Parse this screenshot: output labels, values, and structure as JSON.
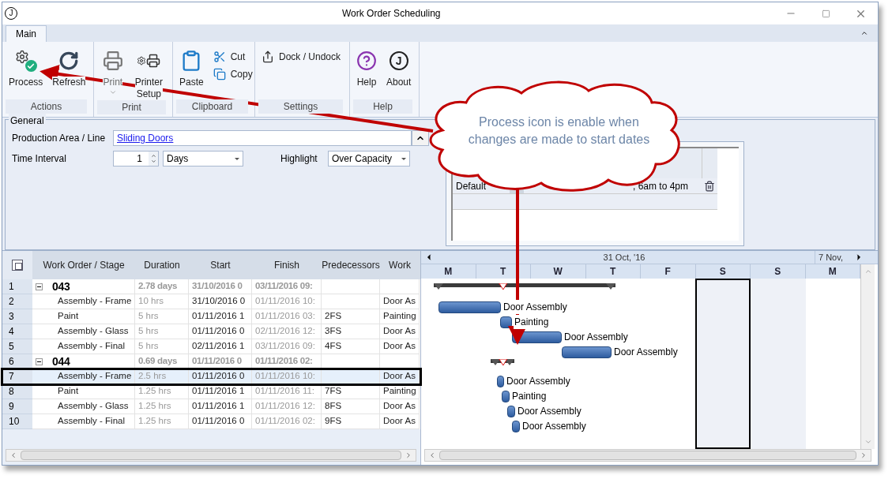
{
  "window": {
    "logo": "J",
    "title": "Work Order Scheduling"
  },
  "tabs": [
    {
      "label": "Main",
      "selected": true
    }
  ],
  "ribbon_groups": [
    {
      "label": "Actions",
      "buttons": [
        {
          "label": "Process",
          "kind": "large",
          "disabled": false
        },
        {
          "label": "Refresh",
          "kind": "large",
          "disabled": false
        }
      ]
    },
    {
      "label": "Print",
      "buttons": [
        {
          "label": "Print",
          "kind": "split",
          "disabled": true
        },
        {
          "label": "Printer Setup",
          "kind": "large",
          "disabled": false
        }
      ]
    },
    {
      "label": "Clipboard",
      "buttons": [
        {
          "label": "Paste",
          "kind": "large",
          "disabled": false
        },
        {
          "label": "Cut",
          "kind": "small",
          "disabled": false
        },
        {
          "label": "Copy",
          "kind": "small",
          "disabled": false
        }
      ]
    },
    {
      "label": "Settings",
      "buttons": [
        {
          "label": "Dock / Undock",
          "kind": "small",
          "disabled": false
        }
      ]
    },
    {
      "label": "Help",
      "buttons": [
        {
          "label": "Help",
          "kind": "large",
          "disabled": false
        },
        {
          "label": "About",
          "kind": "large",
          "disabled": false,
          "icon_letter": "J"
        }
      ]
    }
  ],
  "general": {
    "legend": "General",
    "production_area": {
      "label": "Production Area / Line",
      "value": "Sliding Doors"
    },
    "time_interval": {
      "label": "Time Interval",
      "value": "1",
      "unit": "Days"
    },
    "highlight": {
      "label": "Highlight",
      "value": "Over Capacity"
    },
    "shifts": {
      "rows": [
        {
          "column_1": "Default",
          "column_3": ", 6am to 4pm"
        }
      ]
    }
  },
  "grid": {
    "columns": [
      "Work Order / Stage",
      "Duration",
      "Start",
      "Finish",
      "Predecessors",
      "Work"
    ],
    "rows": [
      {
        "number": "1",
        "kind": "order",
        "expanded": true,
        "selected": false,
        "name": "043",
        "duration": "2.78 days",
        "start": "31/10/2016 0",
        "finish": "03/11/2016 09:",
        "predecessors": "",
        "work": ""
      },
      {
        "number": "2",
        "kind": "stage",
        "selected": false,
        "name": "Assembly - Frame",
        "duration": "10 hrs",
        "start": "31/10/2016 0",
        "finish": "01/11/2016 10:",
        "predecessors": "",
        "work": "Door As"
      },
      {
        "number": "3",
        "kind": "stage",
        "selected": false,
        "name": "Paint",
        "duration": "5 hrs",
        "start": "01/11/2016 1",
        "finish": "01/11/2016 03:",
        "predecessors": "2FS",
        "work": "Painting"
      },
      {
        "number": "4",
        "kind": "stage",
        "selected": false,
        "name": "Assembly - Glass",
        "duration": "5 hrs",
        "start": "01/11/2016 0",
        "finish": "02/11/2016 12:",
        "predecessors": "3FS",
        "work": "Door As"
      },
      {
        "number": "5",
        "kind": "stage",
        "selected": false,
        "name": "Assembly - Final",
        "duration": "5 hrs",
        "start": "02/11/2016 1",
        "finish": "03/11/2016 09:",
        "predecessors": "4FS",
        "work": "Door As"
      },
      {
        "number": "6",
        "kind": "order",
        "expanded": true,
        "selected": false,
        "name": "044",
        "duration": "0.69 days",
        "start": "01/11/2016 0",
        "finish": "01/11/2016 02:",
        "predecessors": "",
        "work": ""
      },
      {
        "number": "7",
        "kind": "stage",
        "selected": true,
        "name": "Assembly - Frame",
        "duration": "2.5 hrs",
        "start": "01/11/2016 0",
        "finish": "01/11/2016 10:",
        "predecessors": "",
        "work": "Door As"
      },
      {
        "number": "8",
        "kind": "stage",
        "selected": false,
        "name": "Paint",
        "duration": "1.25 hrs",
        "start": "01/11/2016 1",
        "finish": "01/11/2016 11:",
        "predecessors": "7FS",
        "work": "Painting"
      },
      {
        "number": "9",
        "kind": "stage",
        "selected": false,
        "name": "Assembly - Glass",
        "duration": "1.25 hrs",
        "start": "01/11/2016 1",
        "finish": "01/11/2016 12:",
        "predecessors": "8FS",
        "work": "Door As"
      },
      {
        "number": "10",
        "kind": "stage",
        "selected": false,
        "name": "Assembly - Final",
        "duration": "1.25 hrs",
        "start": "01/11/2016 0",
        "finish": "01/11/2016 02:",
        "predecessors": "9FS",
        "work": "Door As"
      }
    ]
  },
  "gantt": {
    "periods": [
      "31 Oct, '16",
      "7 Nov,"
    ],
    "days": [
      {
        "label": "M",
        "kind": "weekday"
      },
      {
        "label": "T",
        "kind": "weekday"
      },
      {
        "label": "W",
        "kind": "weekday"
      },
      {
        "label": "T",
        "kind": "weekday"
      },
      {
        "label": "F",
        "kind": "weekday"
      },
      {
        "label": "S",
        "kind": "weekend",
        "selected": true
      },
      {
        "label": "S",
        "kind": "weekend",
        "selected": false
      },
      {
        "label": "M",
        "kind": "weekday"
      }
    ],
    "bars": [
      {
        "kind": "summary"
      },
      {
        "kind": "task",
        "label": "Door Assembly"
      },
      {
        "kind": "task",
        "label": "Painting"
      },
      {
        "kind": "task",
        "label": "Door Assembly"
      },
      {
        "kind": "task",
        "label": "Door Assembly"
      },
      {
        "kind": "summary"
      },
      {
        "kind": "task",
        "label": "Door Assembly"
      },
      {
        "kind": "task",
        "label": "Painting"
      },
      {
        "kind": "task",
        "label": "Door Assembly"
      },
      {
        "kind": "task",
        "label": "Door Assembly"
      }
    ]
  },
  "callout": {
    "text": "Process icon is enable when changes are made to start dates"
  }
}
